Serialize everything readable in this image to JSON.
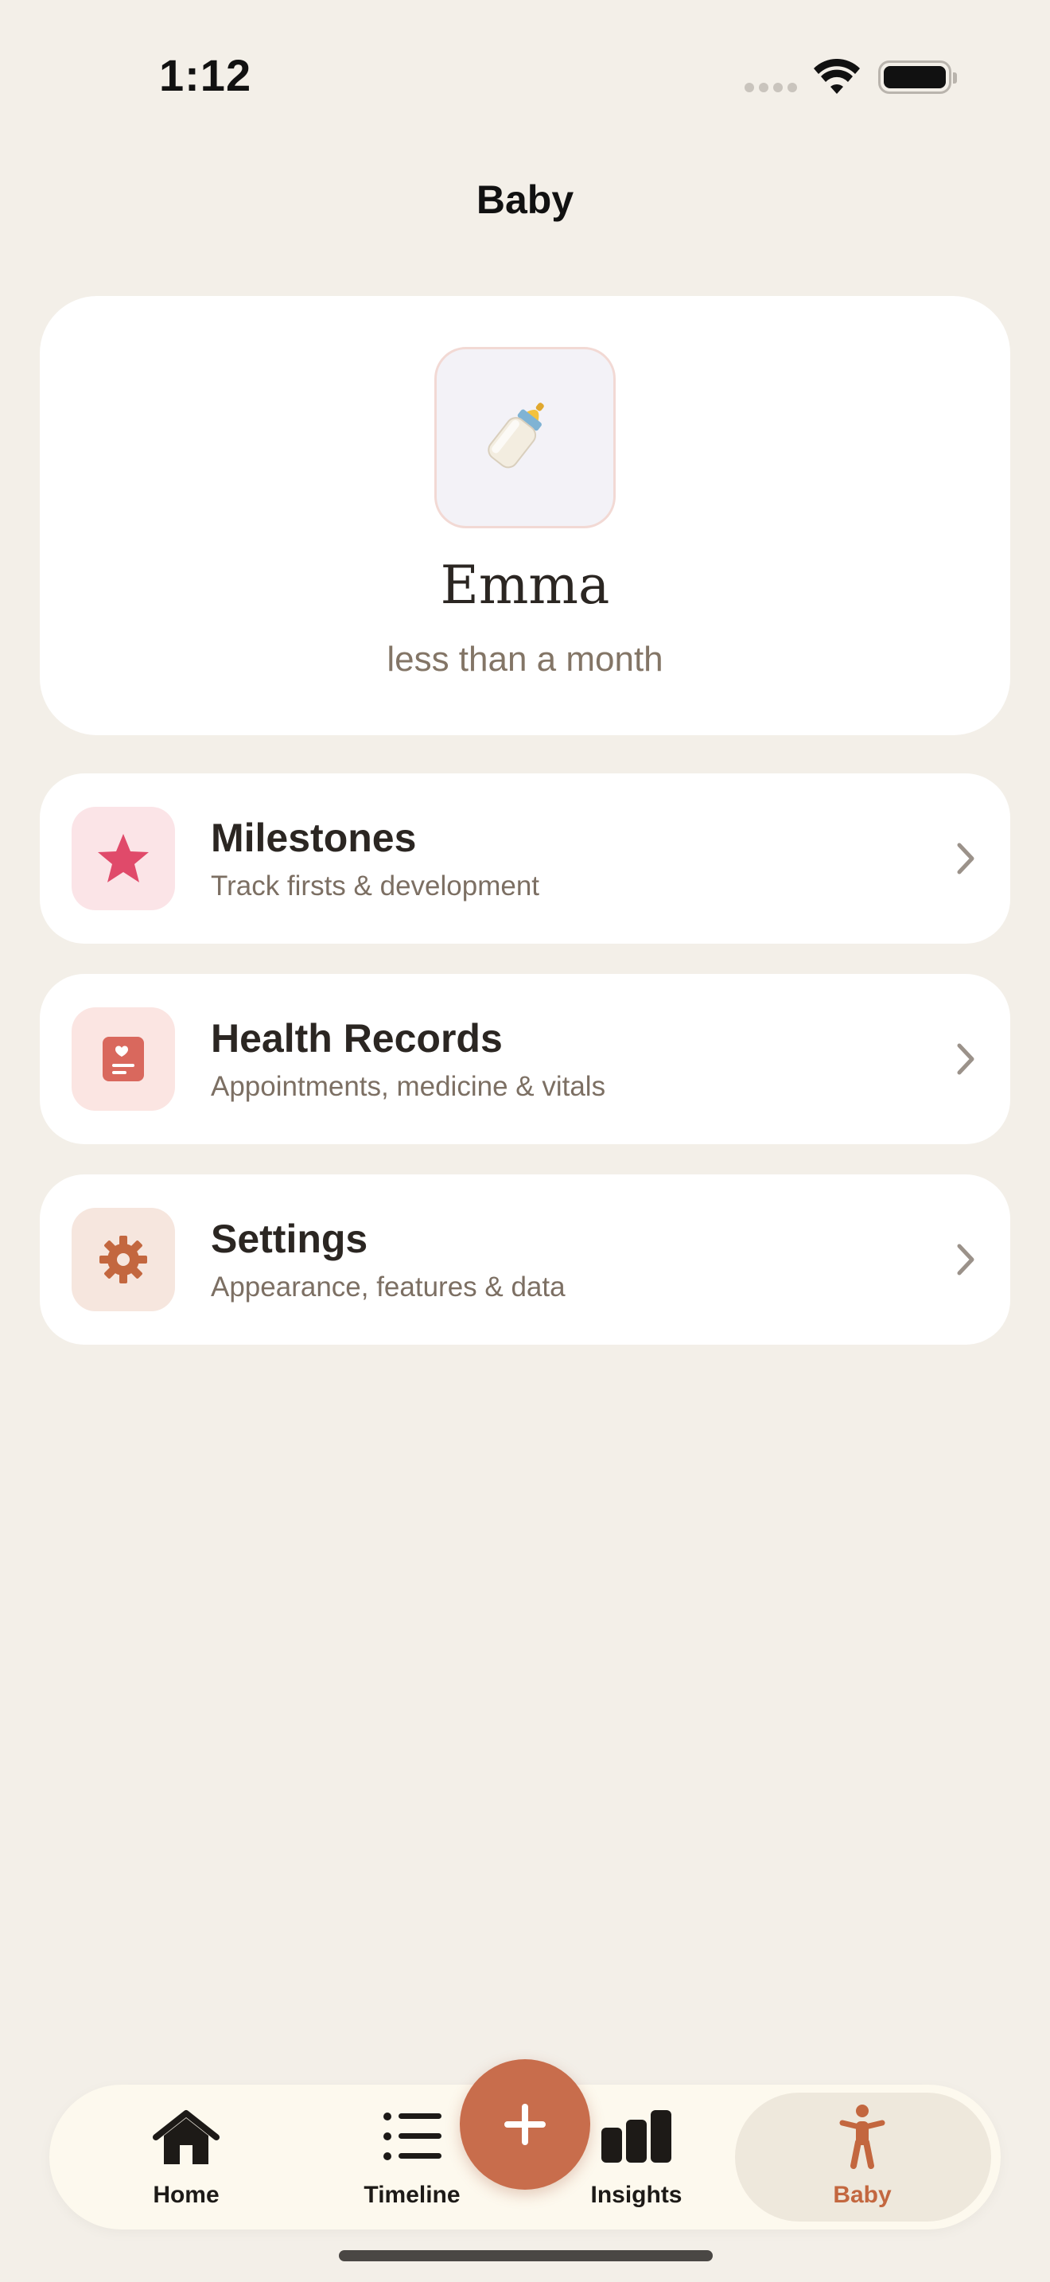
{
  "status_bar": {
    "time": "1:12"
  },
  "nav": {
    "title": "Baby"
  },
  "profile": {
    "avatar_icon": "baby-bottle-icon",
    "name": "Emma",
    "age": "less than a month"
  },
  "menu": [
    {
      "title": "Milestones",
      "subtitle": "Track firsts & development",
      "icon": "star-icon",
      "icon_color": "#e04a6a",
      "icon_bg": "#fbe4e7"
    },
    {
      "title": "Health Records",
      "subtitle": "Appointments, medicine & vitals",
      "icon": "health-record-icon",
      "icon_color": "#d9685d",
      "icon_bg": "#fbe5e2"
    },
    {
      "title": "Settings",
      "subtitle": "Appearance, features & data",
      "icon": "gear-icon",
      "icon_color": "#c3673f",
      "icon_bg": "#f6e6de"
    }
  ],
  "tab_bar": {
    "tabs": [
      {
        "label": "Home",
        "icon": "house-icon"
      },
      {
        "label": "Timeline",
        "icon": "list-icon"
      },
      {
        "label": "Insights",
        "icon": "bar-chart-icon"
      },
      {
        "label": "Baby",
        "icon": "figure-icon",
        "active": true
      }
    ],
    "fab_icon": "plus-icon"
  },
  "colors": {
    "background": "#f3efe8",
    "accent": "#c86d4c",
    "active_tab_label": "#c3673f"
  }
}
